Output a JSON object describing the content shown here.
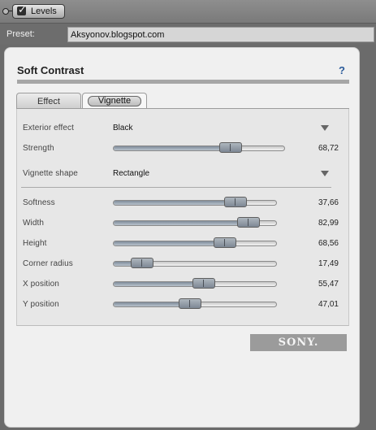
{
  "chain": {
    "levels_label": "Levels"
  },
  "preset": {
    "label": "Preset:",
    "value": "Aksyonov.blogspot.com"
  },
  "panel": {
    "title": "Soft Contrast",
    "help": "?",
    "tabs": [
      {
        "label": "Effect",
        "active": false
      },
      {
        "label": "Vignette",
        "active": true
      }
    ],
    "exterior_effect": {
      "label": "Exterior effect",
      "value": "Black"
    },
    "strength": {
      "label": "Strength",
      "value": "68,72",
      "fraction": 0.6872
    },
    "vignette_shape": {
      "label": "Vignette shape",
      "value": "Rectangle"
    },
    "sliders": [
      {
        "label": "Softness",
        "value": "37,66",
        "fraction": 0.75
      },
      {
        "label": "Width",
        "value": "82,99",
        "fraction": 0.83
      },
      {
        "label": "Height",
        "value": "68,56",
        "fraction": 0.6856
      },
      {
        "label": "Corner radius",
        "value": "17,49",
        "fraction": 0.1749
      },
      {
        "label": "X position",
        "value": "55,47",
        "fraction": 0.5547
      },
      {
        "label": "Y position",
        "value": "47,01",
        "fraction": 0.4701
      }
    ],
    "brand": "SONY."
  }
}
